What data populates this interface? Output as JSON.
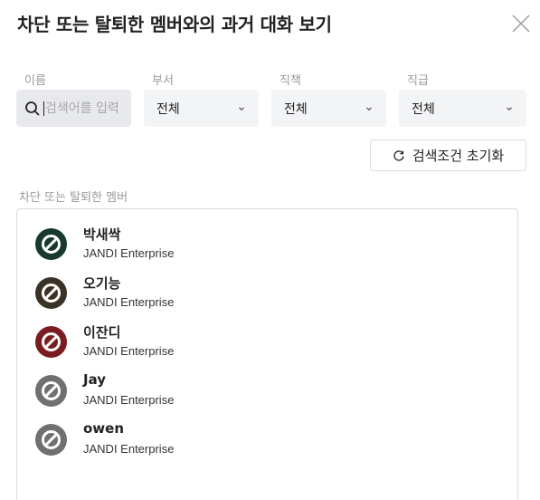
{
  "dialog": {
    "title": "차단 또는 탈퇴한 멤버와의 과거 대화 보기"
  },
  "filters": {
    "name_label": "이름",
    "search_placeholder": "검색어를 입력",
    "department_label": "부서",
    "department_value": "전체",
    "duty_label": "직책",
    "duty_value": "전체",
    "rank_label": "직급",
    "rank_value": "전체"
  },
  "reset_button": {
    "label": "검색조건 초기화",
    "icon": "refresh-icon"
  },
  "members_section": {
    "label": "차단 또는 탈퇴한 멤버",
    "items": [
      {
        "name": "박새싹",
        "org": "JANDI Enterprise",
        "avatar_color": "#173a2c"
      },
      {
        "name": "오기능",
        "org": "JANDI Enterprise",
        "avatar_color": "#3a3226"
      },
      {
        "name": "이잔디",
        "org": "JANDI Enterprise",
        "avatar_color": "#7a1c20"
      },
      {
        "name": "Jay",
        "org": "JANDI Enterprise",
        "avatar_color": "#707070"
      },
      {
        "name": "owen",
        "org": "JANDI Enterprise",
        "avatar_color": "#707070"
      }
    ]
  },
  "icons": {
    "close": "close-icon",
    "search": "search-icon",
    "chevron": "chevron-down-icon",
    "blocked": "blocked-avatar-icon"
  },
  "colors": {
    "field_background": "#f3f4f6",
    "border": "#dcdcdc",
    "label_gray": "#9a9a9a"
  }
}
